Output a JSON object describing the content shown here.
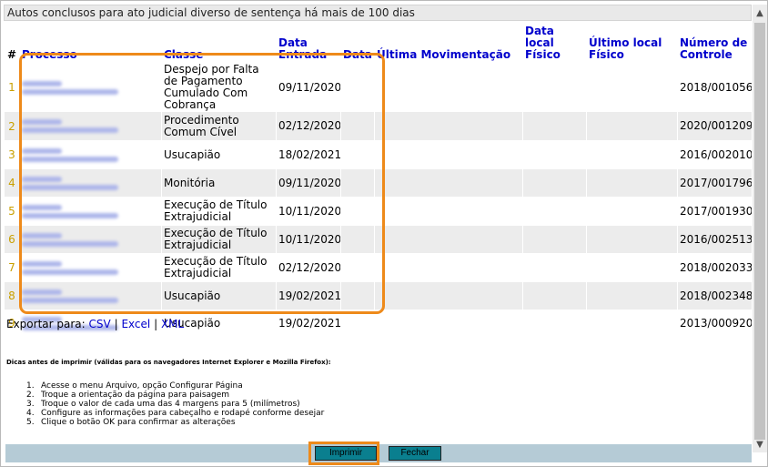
{
  "title": "Autos conclusos para ato judicial diverso de sentença há mais de 100 dias",
  "columns": {
    "hash": "#",
    "processo": "Processo",
    "classe": "Classe",
    "data_entrada": "Data Entrada",
    "data": "Data",
    "ultima_movimentacao": "Última Movimentação",
    "data_local_fisico": "Data local Físico",
    "ultimo_local_fisico": "Último local Físico",
    "numero_controle": "Número de Controle"
  },
  "rows": [
    {
      "idx": "1",
      "classe": "Despejo por Falta de Pagamento Cumulado Com Cobrança",
      "data_entrada": "09/11/2020",
      "controle": "2018/001056"
    },
    {
      "idx": "2",
      "classe": "Procedimento Comum Cível",
      "data_entrada": "02/12/2020",
      "controle": "2020/001209"
    },
    {
      "idx": "3",
      "classe": "Usucapião",
      "data_entrada": "18/02/2021",
      "controle": "2016/002010"
    },
    {
      "idx": "4",
      "classe": "Monitória",
      "data_entrada": "09/11/2020",
      "controle": "2017/001796"
    },
    {
      "idx": "5",
      "classe": "Execução de Título Extrajudicial",
      "data_entrada": "10/11/2020",
      "controle": "2017/001930"
    },
    {
      "idx": "6",
      "classe": "Execução de Título Extrajudicial",
      "data_entrada": "10/11/2020",
      "controle": "2016/002513"
    },
    {
      "idx": "7",
      "classe": "Execução de Título Extrajudicial",
      "data_entrada": "02/12/2020",
      "controle": "2018/002033"
    },
    {
      "idx": "8",
      "classe": "Usucapião",
      "data_entrada": "19/02/2021",
      "controle": "2018/002348"
    },
    {
      "idx": "9",
      "classe": "Usucapião",
      "data_entrada": "19/02/2021",
      "controle": "2013/000920"
    }
  ],
  "export": {
    "label": "Exportar para:",
    "sep": "|",
    "csv": "CSV",
    "excel": "Excel",
    "xml": "XML"
  },
  "tips": {
    "title": "Dicas antes de imprimir (válidas para os navegadores Internet Explorer e Mozilla Firefox):",
    "items": [
      {
        "n": "1.",
        "text": "Acesse o menu Arquivo, opção Configurar Página"
      },
      {
        "n": "2.",
        "text": "Troque a orientação da página para paisagem"
      },
      {
        "n": "3.",
        "text": "Troque o valor de cada uma das 4 margens para 5 (milímetros)"
      },
      {
        "n": "4.",
        "text": "Configure as informações para cabeçalho e rodapé conforme desejar"
      },
      {
        "n": "5.",
        "text": "Clique o botão OK para confirmar as alterações"
      }
    ]
  },
  "buttons": {
    "print": "Imprimir",
    "close": "Fechar"
  },
  "colors": {
    "highlight": "#ee8a1a",
    "header_link": "#0000cc",
    "row_index": "#c9a000",
    "button": "#0a7f8f"
  }
}
